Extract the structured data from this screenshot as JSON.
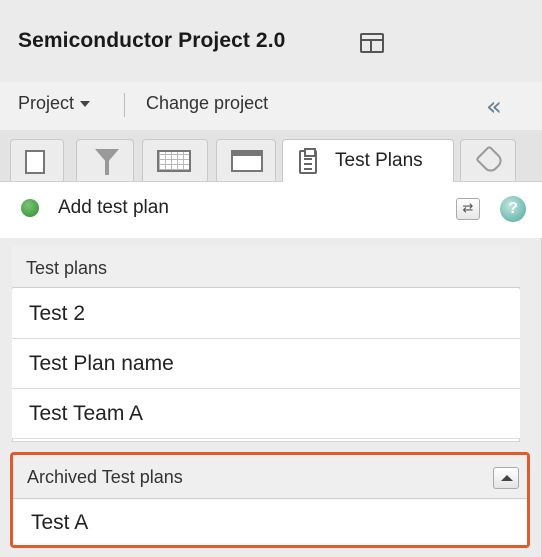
{
  "header": {
    "title": "Semiconductor Project 2.0",
    "layout_icon": "layout-icon"
  },
  "project_bar": {
    "project_menu_label": "Project",
    "change_project_label": "Change project",
    "collapse_icon": "double-chevron-left-icon"
  },
  "tabs": [
    {
      "icon": "document-icon",
      "label": ""
    },
    {
      "icon": "filter-icon",
      "label": ""
    },
    {
      "icon": "grid-icon",
      "label": ""
    },
    {
      "icon": "window-icon",
      "label": ""
    },
    {
      "icon": "clipboard-icon",
      "label": "Test Plans",
      "active": true
    },
    {
      "icon": "tag-icon",
      "label": ""
    }
  ],
  "toolbar": {
    "add_label": "Add test plan",
    "refresh_glyph": "⇄",
    "help_glyph": "?"
  },
  "test_plans": {
    "header": "Test plans",
    "items": [
      "Test 2",
      "Test Plan name",
      "Test Team A"
    ]
  },
  "archived": {
    "header": "Archived Test plans",
    "items": [
      "Test A"
    ]
  },
  "colors": {
    "highlight_border": "#e05a2b",
    "add_icon_green": "#2e8b2e",
    "help_icon_teal": "#4fa89c"
  }
}
